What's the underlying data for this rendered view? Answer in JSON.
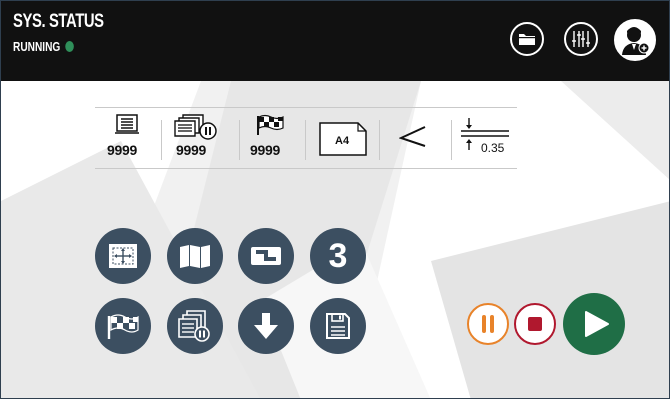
{
  "header": {
    "title": "SYS. STATUS",
    "status": "RUNNING",
    "status_color": "#2f8f5a",
    "folder_icon": "folder-icon",
    "settings_icon": "sliders-icon",
    "user_icon": "operator-add-icon"
  },
  "info_bar": {
    "sheet_count": "9999",
    "batch_count": "9999",
    "finish_count": "9999",
    "paper_size": "A4",
    "offset_value": "0.35"
  },
  "functions": {
    "mode_number": "3",
    "button_color": "#3c4f61"
  },
  "controls": {
    "pause_color": "#e8832a",
    "stop_color": "#b0182e",
    "play_color": "#1f6e46"
  }
}
